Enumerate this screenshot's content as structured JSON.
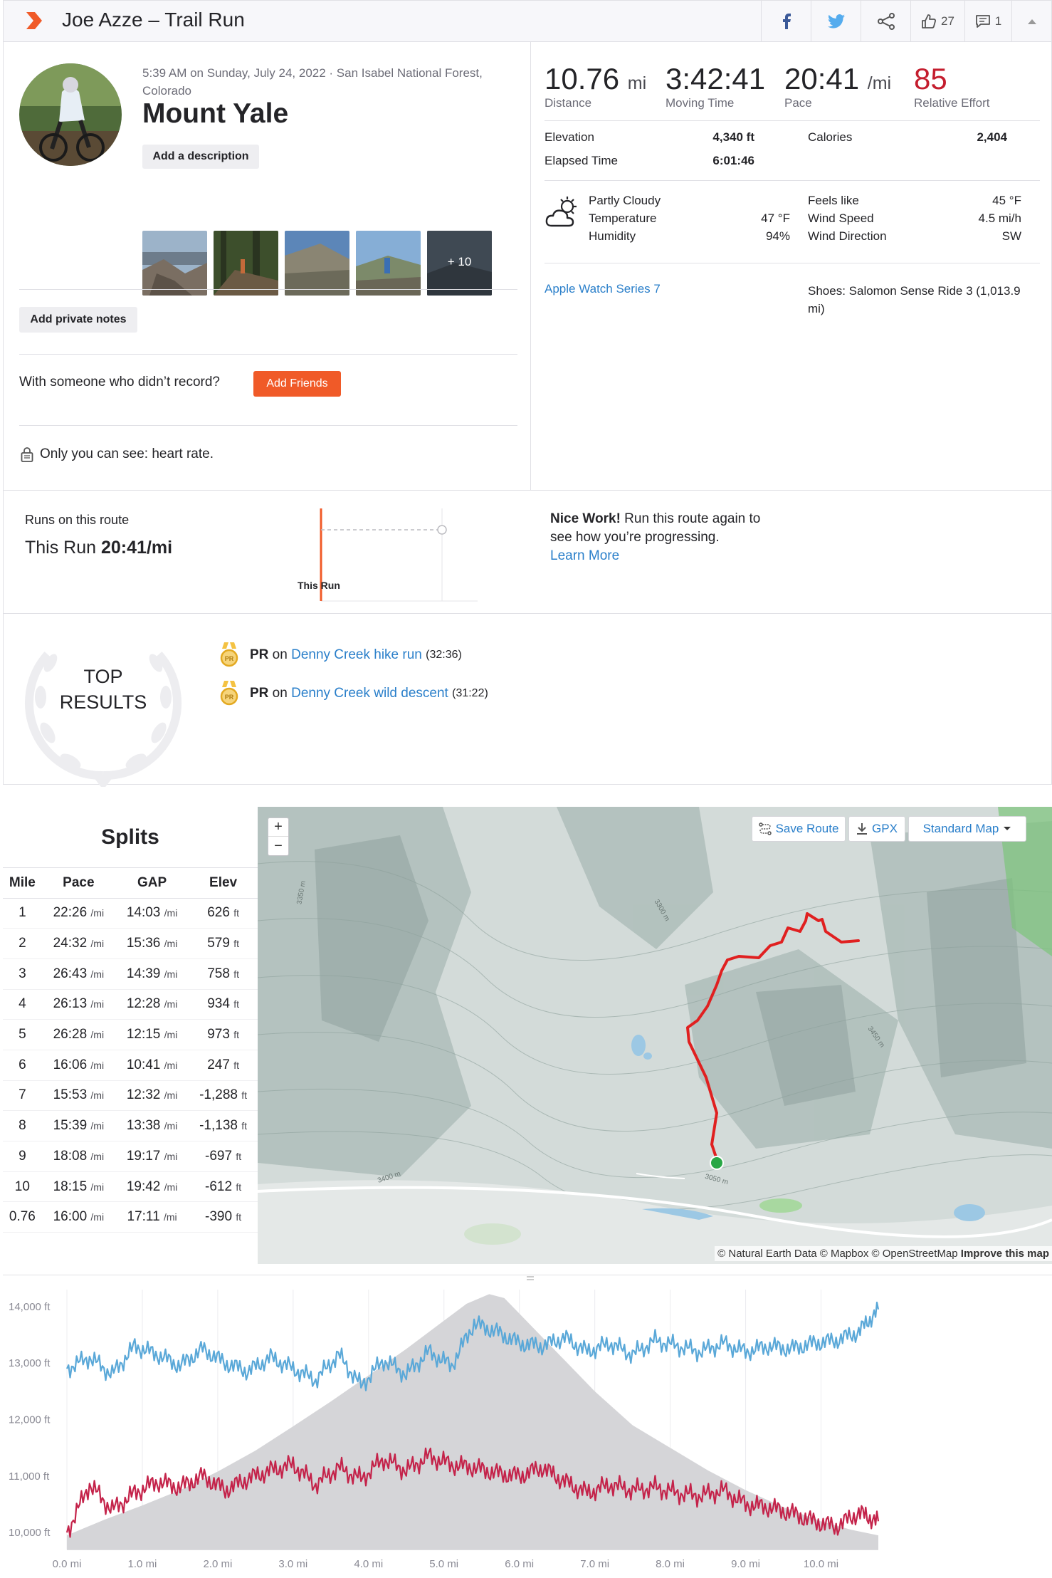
{
  "header": {
    "title": "Joe Azze – Trail Run",
    "kudos_count": "27",
    "comment_count": "1"
  },
  "activity": {
    "datetime_location": "5:39 AM on Sunday, July 24, 2022 · San Isabel National Forest, Colorado",
    "name": "Mount Yale",
    "add_description": "Add a description",
    "more_photos": "+ 10",
    "add_private_notes": "Add private notes",
    "with_someone_prompt": "With someone who didn’t record?",
    "add_friends": "Add Friends",
    "privacy_note": "Only you can see: heart rate."
  },
  "stats": {
    "distance": {
      "value": "10.76",
      "unit": "mi",
      "label": "Distance"
    },
    "moving_time": {
      "value": "3:42:41",
      "label": "Moving Time"
    },
    "pace": {
      "value": "20:41",
      "unit": "/mi",
      "label": "Pace"
    },
    "relative_effort": {
      "value": "85",
      "label": "Relative Effort"
    },
    "elevation_label": "Elevation",
    "elevation_value": "4,340 ft",
    "elapsed_label": "Elapsed Time",
    "elapsed_value": "6:01:46",
    "calories_label": "Calories",
    "calories_value": "2,404",
    "device": "Apple Watch Series 7",
    "shoes": "Shoes: Salomon Sense Ride 3 (1,013.9 mi)"
  },
  "weather": {
    "condition": "Partly Cloudy",
    "temperature_label": "Temperature",
    "temperature_value": "47 °F",
    "humidity_label": "Humidity",
    "humidity_value": "94%",
    "feels_like_label": "Feels like",
    "feels_like_value": "45 °F",
    "wind_speed_label": "Wind Speed",
    "wind_speed_value": "4.5 mi/h",
    "wind_direction_label": "Wind Direction",
    "wind_direction_value": "SW"
  },
  "route": {
    "runs_label": "Runs on this route",
    "this_run_label": "This Run",
    "this_run_value": "20:41/mi",
    "chart_label": "This Run",
    "nice_work_bold": "Nice Work!",
    "nice_work_text": " Run this route again to see how you’re progressing.",
    "learn_more": "Learn More"
  },
  "top_results": {
    "title_line1": "TOP",
    "title_line2": "RESULTS",
    "items": [
      {
        "pr": "PR",
        "on": " on ",
        "segment": "Denny Creek hike run",
        "time": "(32:36)"
      },
      {
        "pr": "PR",
        "on": " on ",
        "segment": "Denny Creek wild descent",
        "time": "(31:22)"
      }
    ]
  },
  "splits": {
    "title": "Splits",
    "headers": [
      "Mile",
      "Pace",
      "GAP",
      "Elev"
    ],
    "rows": [
      {
        "mile": "1",
        "pace": "22:26",
        "gap": "14:03",
        "elev": "626"
      },
      {
        "mile": "2",
        "pace": "24:32",
        "gap": "15:36",
        "elev": "579"
      },
      {
        "mile": "3",
        "pace": "26:43",
        "gap": "14:39",
        "elev": "758"
      },
      {
        "mile": "4",
        "pace": "26:13",
        "gap": "12:28",
        "elev": "934"
      },
      {
        "mile": "5",
        "pace": "26:28",
        "gap": "12:15",
        "elev": "973"
      },
      {
        "mile": "6",
        "pace": "16:06",
        "gap": "10:41",
        "elev": "247"
      },
      {
        "mile": "7",
        "pace": "15:53",
        "gap": "12:32",
        "elev": "-1,288"
      },
      {
        "mile": "8",
        "pace": "15:39",
        "gap": "13:38",
        "elev": "-1,138"
      },
      {
        "mile": "9",
        "pace": "18:08",
        "gap": "19:17",
        "elev": "-697"
      },
      {
        "mile": "10",
        "pace": "18:15",
        "gap": "19:42",
        "elev": "-612"
      },
      {
        "mile": "0.76",
        "pace": "16:00",
        "gap": "17:11",
        "elev": "-390"
      }
    ],
    "pace_unit": "/mi",
    "elev_unit": "ft"
  },
  "map": {
    "zoom_in": "+",
    "zoom_out": "−",
    "save_route": "Save Route",
    "gpx": "GPX",
    "map_type": "Standard Map",
    "attribution_plain": "© Natural Earth Data © Mapbox © OpenStreetMap ",
    "attribution_link": "Improve this map",
    "contour_labels": [
      "3350 m",
      "3300 m",
      "3450 m",
      "3400 m",
      "3050 m"
    ]
  },
  "chart_data": {
    "type": "area",
    "x_ticks": [
      "0.0 mi",
      "1.0 mi",
      "2.0 mi",
      "3.0 mi",
      "4.0 mi",
      "5.0 mi",
      "6.0 mi",
      "7.0 mi",
      "8.0 mi",
      "9.0 mi",
      "10.0 mi"
    ],
    "y_ticks": [
      "14,000 ft",
      "13,000 ft",
      "12,000 ft",
      "11,000 ft",
      "10,000 ft"
    ],
    "xlim": [
      0,
      10.76
    ],
    "ylim": [
      9700,
      14300
    ],
    "elevation": {
      "x": [
        0,
        0.5,
        1.0,
        1.5,
        2.0,
        2.5,
        3.0,
        3.5,
        4.0,
        4.5,
        5.0,
        5.3,
        5.6,
        5.8,
        6.2,
        6.6,
        7.0,
        7.5,
        8.0,
        8.5,
        9.0,
        9.5,
        10.0,
        10.4,
        10.76
      ],
      "y": [
        9950,
        10230,
        10480,
        10750,
        11080,
        11450,
        11880,
        12320,
        12780,
        13250,
        13750,
        14050,
        14220,
        14150,
        13600,
        13050,
        12500,
        11900,
        11500,
        11100,
        10750,
        10450,
        10200,
        10050,
        9950
      ]
    },
    "pace_series": {
      "color": "#5aa8d8",
      "x": [
        0,
        0.3,
        0.6,
        0.9,
        1.2,
        1.5,
        1.8,
        2.1,
        2.4,
        2.7,
        3.0,
        3.3,
        3.6,
        3.9,
        4.2,
        4.5,
        4.8,
        5.1,
        5.4,
        5.7,
        6.0,
        6.3,
        6.6,
        6.9,
        7.2,
        7.5,
        7.8,
        8.1,
        8.4,
        8.7,
        9.0,
        9.3,
        9.6,
        9.9,
        10.2,
        10.5,
        10.76
      ],
      "y": [
        12900,
        13100,
        12800,
        13300,
        13150,
        12950,
        13250,
        13000,
        12850,
        13100,
        12900,
        12700,
        13150,
        12600,
        13050,
        12800,
        13200,
        12950,
        13700,
        13550,
        13350,
        13300,
        13450,
        13200,
        13350,
        13150,
        13400,
        13300,
        13200,
        13350,
        13200,
        13300,
        13250,
        13350,
        13400,
        13550,
        13950
      ]
    },
    "hr_series": {
      "color": "#c4234a",
      "x": [
        0,
        0.3,
        0.6,
        0.9,
        1.2,
        1.5,
        1.8,
        2.1,
        2.4,
        2.7,
        3.0,
        3.3,
        3.6,
        3.9,
        4.2,
        4.5,
        4.8,
        5.1,
        5.4,
        5.7,
        6.0,
        6.3,
        6.6,
        6.9,
        7.2,
        7.5,
        7.8,
        8.1,
        8.4,
        8.7,
        9.0,
        9.3,
        9.6,
        9.9,
        10.2,
        10.5,
        10.76
      ],
      "y": [
        10000,
        10850,
        10400,
        10700,
        10900,
        10800,
        11000,
        10750,
        10950,
        11100,
        11200,
        10850,
        11150,
        10950,
        11300,
        11100,
        11350,
        11200,
        11150,
        11050,
        11000,
        11150,
        10900,
        10700,
        10850,
        10750,
        10800,
        10700,
        10650,
        10750,
        10500,
        10450,
        10350,
        10200,
        10100,
        10350,
        10200
      ]
    }
  }
}
